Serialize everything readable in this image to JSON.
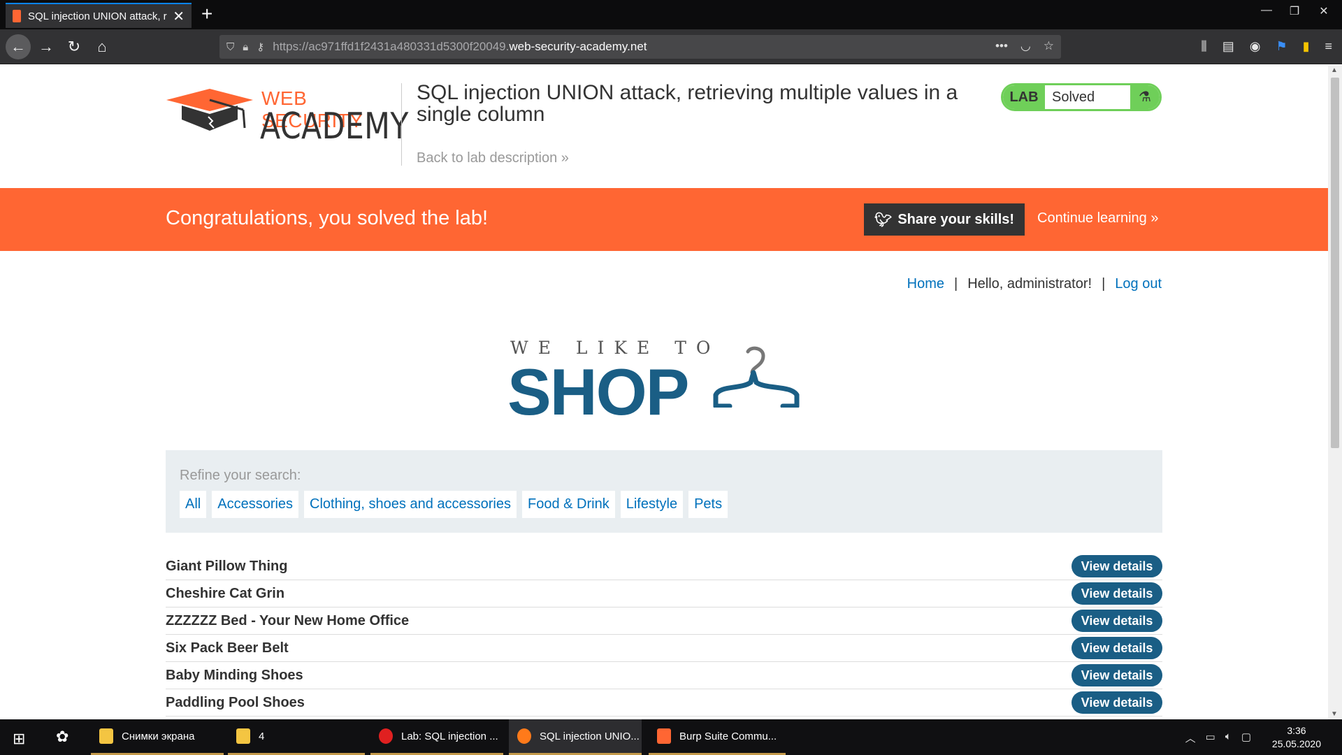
{
  "browser": {
    "tab_title": "SQL injection UNION attack, retrieving multiple values in a single column",
    "url_prefix": "https://ac971ffd1f2431a480331d5300f20049.",
    "url_domain": "web-security-academy.net"
  },
  "header": {
    "logo_line1": "WEB SECURITY",
    "logo_line2": "ACADEMY",
    "lab_title": "SQL injection UNION attack, retrieving multiple values in a single column",
    "back_link": "Back to lab description",
    "badge_label": "LAB",
    "badge_status": "Solved"
  },
  "banner": {
    "message": "Congratulations, you solved the lab!",
    "share_label": "Share your skills!",
    "continue_label": "Continue learning"
  },
  "nav": {
    "home": "Home",
    "greeting": "Hello, administrator!",
    "logout": "Log out"
  },
  "shop_logo": {
    "tagline": "WE LIKE TO",
    "name": "SHOP"
  },
  "search": {
    "label": "Refine your search:",
    "filters": [
      "All",
      "Accessories",
      "Clothing, shoes and accessories",
      "Food & Drink",
      "Lifestyle",
      "Pets"
    ]
  },
  "products": {
    "button_label": "View details",
    "items": [
      "Giant Pillow Thing",
      "Cheshire Cat Grin",
      "ZZZZZZ Bed - Your New Home Office",
      "Six Pack Beer Belt",
      "Baby Minding Shoes",
      "Paddling Pool Shoes"
    ]
  },
  "taskbar": {
    "items": [
      "Снимки экрана",
      "4",
      "Lab: SQL injection ...",
      "SQL injection UNIO...",
      "Burp Suite Commu..."
    ],
    "time": "3:36",
    "date": "25.05.2020"
  },
  "colors": {
    "accent_orange": "#ff6633",
    "shop_blue": "#1a5e85",
    "link_blue": "#0071bc",
    "solved_green": "#6fcf59"
  }
}
